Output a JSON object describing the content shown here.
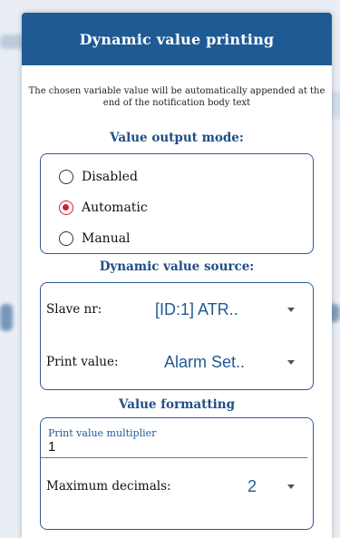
{
  "dialog": {
    "title": "Dynamic value printing",
    "description": "The chosen variable value will be automatically appended at the end of the notification body text"
  },
  "output_mode": {
    "title": "Value output mode:",
    "options": [
      {
        "label": "Disabled",
        "checked": false
      },
      {
        "label": "Automatic",
        "checked": true
      },
      {
        "label": "Manual",
        "checked": false
      }
    ]
  },
  "source": {
    "title": "Dynamic value source:",
    "slave": {
      "label": "Slave nr:",
      "value": "[ID:1] ATR.."
    },
    "print": {
      "label": "Print value:",
      "value": "Alarm Set.."
    }
  },
  "formatting": {
    "title": "Value formatting",
    "multiplier": {
      "label": "Print value multiplier",
      "value": "1"
    },
    "decimals": {
      "label": "Maximum decimals:",
      "value": "2"
    }
  },
  "colors": {
    "header": "#1f5a94",
    "accent": "#1f5a94",
    "radio_selected": "#d3203a"
  }
}
